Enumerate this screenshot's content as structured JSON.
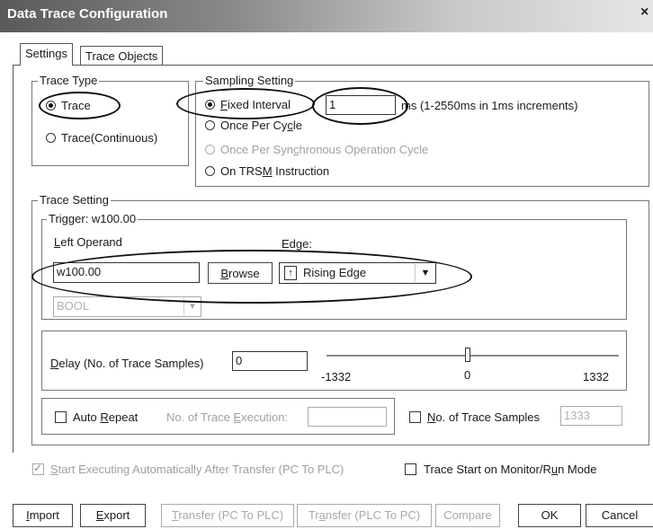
{
  "window": {
    "title": "Data Trace Configuration",
    "close_label": "×"
  },
  "tabs": [
    {
      "label": "Settings"
    },
    {
      "label": "Trace Objects"
    }
  ],
  "trace_type": {
    "legend": "Trace Type",
    "options": [
      {
        "label": "Trace",
        "selected": true
      },
      {
        "label": "Trace(Continuous)",
        "selected": false
      }
    ]
  },
  "sampling": {
    "legend": "Sampling Setting",
    "options": [
      {
        "label": "Fixed Interval",
        "selected": true,
        "enabled": true
      },
      {
        "label": "Once Per Cycle",
        "selected": false,
        "enabled": true
      },
      {
        "label": "Once Per Synchronous Operation Cycle",
        "selected": false,
        "enabled": false
      },
      {
        "label": "On TRSM Instruction",
        "selected": false,
        "enabled": true
      }
    ],
    "interval_value": "1",
    "interval_hint": "ms (1-2550ms in 1ms increments)"
  },
  "trace_setting": {
    "legend": "Trace Setting",
    "trigger_legend": "Trigger: w100.00",
    "left_operand_label": "Left Operand",
    "left_operand_value": "w100.00",
    "browse_label": "Browse",
    "edge_label": "Edge:",
    "edge_icon": "up-arrow-icon",
    "edge_value": "Rising Edge",
    "type_value": "BOOL"
  },
  "delay": {
    "label": "Delay (No. of Trace Samples)",
    "value": "0",
    "slider_min": "-1332",
    "slider_mid": "0",
    "slider_max": "1332",
    "slider_position_fraction": 0.5
  },
  "repeat": {
    "auto_repeat_label": "Auto Repeat",
    "auto_repeat_checked": false,
    "execution_label": "No. of Trace Execution:",
    "execution_value": "",
    "samples_label": "No. of Trace Samples",
    "samples_checked": false,
    "samples_value": "1333"
  },
  "options": {
    "start_auto_label": "Start Executing Automatically After Transfer (PC To PLC)",
    "start_auto_checked": true,
    "monitor_label": "Trace Start on Monitor/Run Mode",
    "monitor_checked": false
  },
  "buttons": {
    "import": "Import",
    "export": "Export",
    "transfer_to_plc": "Transfer (PC To PLC)",
    "transfer_from_plc": "Transfer (PLC To PC)",
    "compare": "Compare",
    "ok": "OK",
    "cancel": "Cancel"
  }
}
